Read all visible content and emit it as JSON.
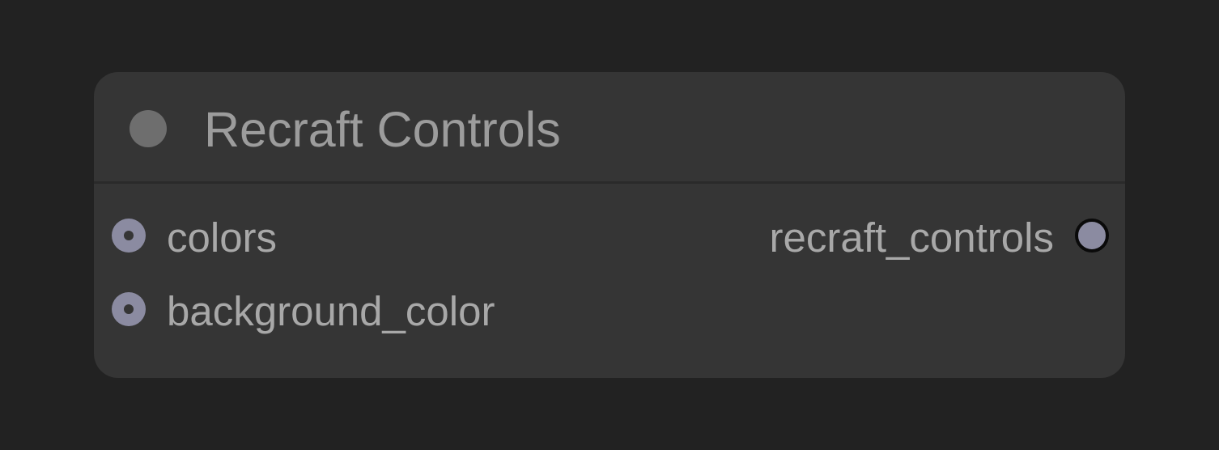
{
  "node": {
    "title": "Recraft Controls",
    "inputs": [
      {
        "label": "colors"
      },
      {
        "label": "background_color"
      }
    ],
    "outputs": [
      {
        "label": "recraft_controls"
      }
    ]
  },
  "colors": {
    "canvas_background": "#222222",
    "node_body": "#353535",
    "title_text": "#9c9c9c",
    "slot_text": "#a8a8a8",
    "socket": "#8b8ba1",
    "collapse_dot": "#6e6e6e"
  }
}
